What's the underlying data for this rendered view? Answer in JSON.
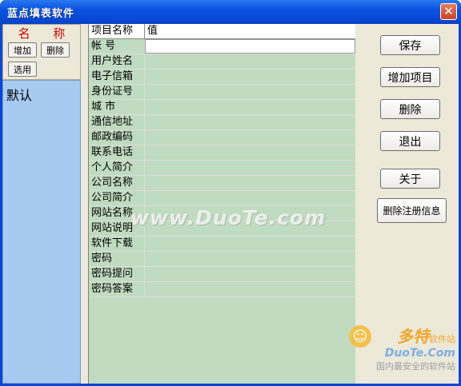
{
  "window": {
    "title": "蓝点填表软件",
    "close_glyph": "✕"
  },
  "left_panel": {
    "title": "名  称",
    "buttons": {
      "add": "增加",
      "delete": "删除",
      "select": "选用"
    },
    "items": [
      "默认"
    ]
  },
  "grid": {
    "headers": [
      "项目名称",
      "值"
    ],
    "rows": [
      {
        "label": "帐     号",
        "value": ""
      },
      {
        "label": "用户姓名",
        "value": ""
      },
      {
        "label": "电子信箱",
        "value": ""
      },
      {
        "label": "身份证号",
        "value": ""
      },
      {
        "label": "城     市",
        "value": ""
      },
      {
        "label": "通信地址",
        "value": ""
      },
      {
        "label": "邮政编码",
        "value": ""
      },
      {
        "label": "联系电话",
        "value": ""
      },
      {
        "label": "个人简介",
        "value": ""
      },
      {
        "label": "公司名称",
        "value": ""
      },
      {
        "label": "公司简介",
        "value": ""
      },
      {
        "label": "网站名称",
        "value": ""
      },
      {
        "label": "网站说明",
        "value": ""
      },
      {
        "label": "软件下载",
        "value": ""
      },
      {
        "label": "密码",
        "value": ""
      },
      {
        "label": "密码提问",
        "value": ""
      },
      {
        "label": "密码答案",
        "value": ""
      }
    ],
    "watermark": "www.DuoTe.com"
  },
  "right_buttons": {
    "save": "保存",
    "add_item": "增加项目",
    "delete": "删除",
    "exit": "退出",
    "about": "关于",
    "remove_reg": "删除注册信息"
  },
  "brand": {
    "name": "多特",
    "sub": "软件站",
    "url": "DuoTe.Com",
    "tagline": "国内最安全的软件站"
  },
  "colors": {
    "titlebar": "#0a52e0",
    "grid_bg": "#c0dcc0",
    "list_bg": "#a6caf0",
    "title_red": "#cc0000"
  }
}
